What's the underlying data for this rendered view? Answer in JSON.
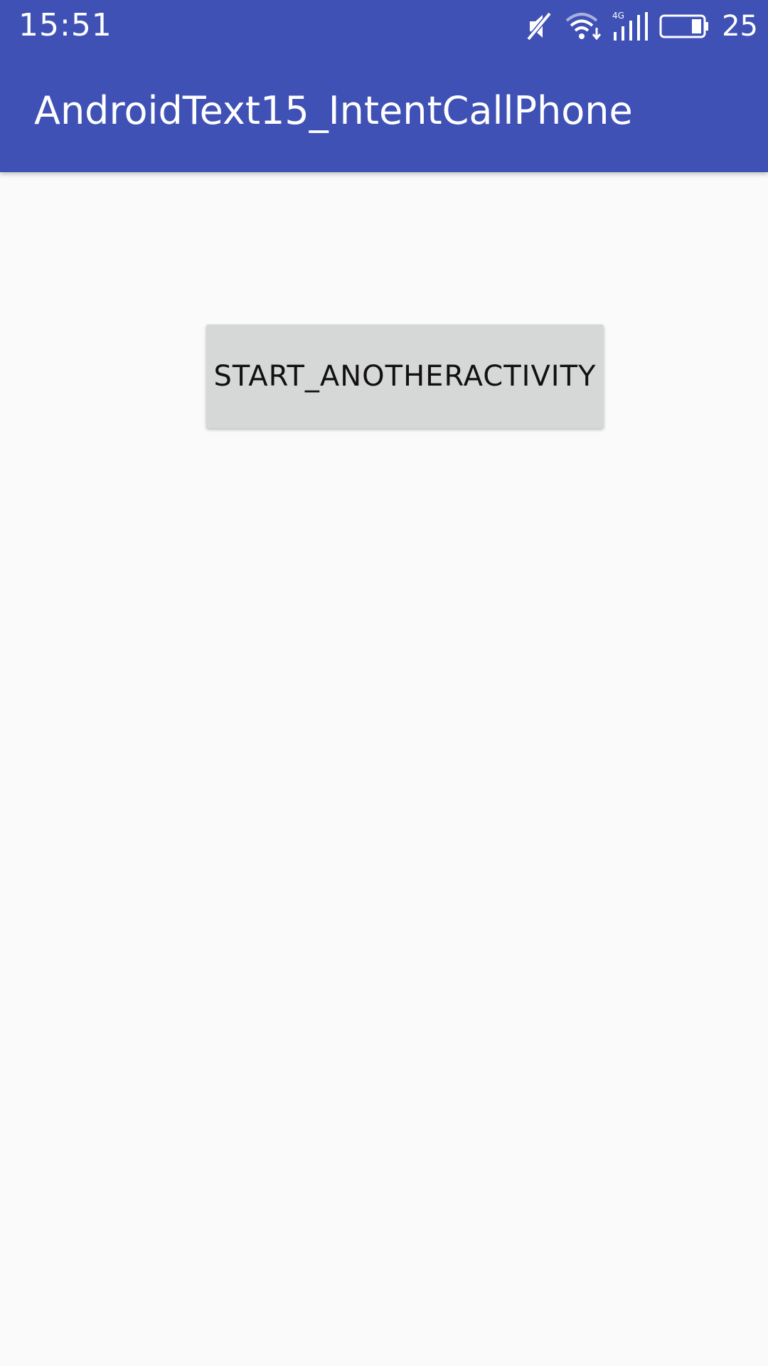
{
  "status_bar": {
    "time": "15:51",
    "icons": [
      "mute-icon",
      "wifi-icon",
      "signal-4g-icon",
      "battery-icon"
    ],
    "battery_percent": "25"
  },
  "app_bar": {
    "title": "AndroidText15_IntentCallPhone",
    "color": "#3f51b5"
  },
  "main": {
    "start_button_label": "START_ANOTHERACTIVITY"
  },
  "colors": {
    "primary": "#3f51b5",
    "background": "#fafafa",
    "button": "#d6d7d7"
  }
}
